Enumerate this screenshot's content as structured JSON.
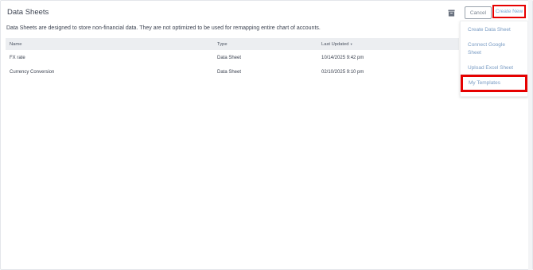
{
  "header": {
    "title": "Data Sheets",
    "cancel_label": "Cancel",
    "create_new_label": "Create New"
  },
  "description": "Data Sheets are designed to store non-financial data. They are not optimized to be used for remapping entire chart of accounts.",
  "table": {
    "columns": {
      "name": "Name",
      "type": "Type",
      "last_updated": "Last Updated"
    },
    "rows": [
      {
        "name": "FX rate",
        "type": "Data Sheet",
        "last_updated": "10/14/2025 9:42 pm"
      },
      {
        "name": "Currency Conversion",
        "type": "Data Sheet",
        "last_updated": "02/10/2025 9:10 pm"
      }
    ]
  },
  "create_menu": {
    "items": [
      {
        "label": "Create Data Sheet"
      },
      {
        "label": "Connect Google Sheet"
      },
      {
        "label": "Upload Excel Sheet"
      },
      {
        "label": "My Templates"
      }
    ]
  },
  "colors": {
    "highlight": "#e60000",
    "menu_text": "#7a9cc4",
    "header_bg": "#eceef1"
  },
  "icons": {
    "archive": "archive-icon",
    "sort": "sort-down-icon"
  }
}
